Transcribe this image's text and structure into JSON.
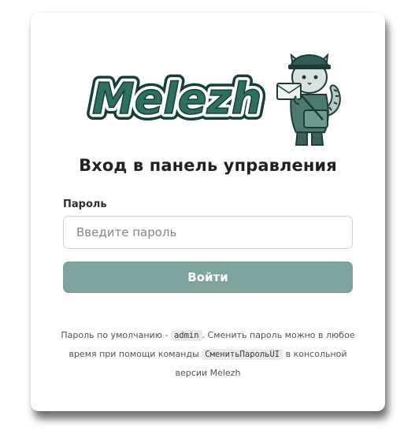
{
  "logo": {
    "wordmark": "Melezh",
    "brand_color": "#2f6e63"
  },
  "title": "Вход в панель управления",
  "password": {
    "label": "Пароль",
    "placeholder": "Введите пароль"
  },
  "login_button": "Войти",
  "hint": {
    "part1": "Пароль по умолчанию - ",
    "default_password": "admin",
    "part2": ". Сменить пароль можно в любое время при помощи команды ",
    "command": "СменитьПарольUI",
    "part3": " в консольной версии Melezh"
  },
  "colors": {
    "accent": "#7ea39f",
    "text": "#1e2226",
    "input_border": "#cfd4d8"
  }
}
